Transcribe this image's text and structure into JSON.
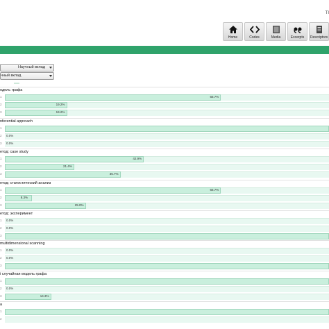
{
  "header": {
    "corner_text": "TI"
  },
  "nav": [
    {
      "label": "Home",
      "icon": "home-icon"
    },
    {
      "label": "Codes",
      "icon": "code-icon"
    },
    {
      "label": "Media",
      "icon": "media-icon"
    },
    {
      "label": "Excerpts",
      "icon": "quote-icon"
    },
    {
      "label": "Descriptors",
      "icon": "descriptors-icon"
    }
  ],
  "colors": {
    "accent": "#2fa36b",
    "bar_fill": "#c9efdd",
    "track": "#e8f8f1"
  },
  "filters": {
    "select1": "Научный вклад",
    "select2": "чный вклад"
  },
  "sections": [
    {
      "title": "одель графа",
      "rows": [
        {
          "label": "1",
          "value": 66.7,
          "text": "66.7%"
        },
        {
          "label": "2",
          "value": 19.2,
          "text": "19.2%"
        },
        {
          "label": "3",
          "value": 19.2,
          "text": "19.2%"
        }
      ]
    },
    {
      "title": "nferential approach",
      "rows": [
        {
          "label": "1",
          "value": 100,
          "text": ""
        },
        {
          "label": "2",
          "value": 0,
          "text": "0.0%"
        },
        {
          "label": "3",
          "value": 0,
          "text": "0.0%"
        }
      ]
    },
    {
      "title": "етод: case study",
      "rows": [
        {
          "label": "1",
          "value": 42.9,
          "text": "42.9%"
        },
        {
          "label": "2",
          "value": 21.4,
          "text": "21.4%"
        },
        {
          "label": "3",
          "value": 35.7,
          "text": "35.7%"
        }
      ]
    },
    {
      "title": "етод: статистический анализ",
      "rows": [
        {
          "label": "1",
          "value": 66.7,
          "text": "66.7%"
        },
        {
          "label": "2",
          "value": 8.3,
          "text": "8.3%"
        },
        {
          "label": "3",
          "value": 25.0,
          "text": "25.0%"
        }
      ]
    },
    {
      "title": "етод: эксперимент",
      "rows": [
        {
          "label": "1",
          "value": 0,
          "text": "0.0%"
        },
        {
          "label": "2",
          "value": 0,
          "text": "0.0%"
        },
        {
          "label": "3",
          "value": 100,
          "text": ""
        }
      ]
    },
    {
      "title": "multidimensional scanning",
      "rows": [
        {
          "label": "1",
          "value": 0,
          "text": "0.0%"
        },
        {
          "label": "2",
          "value": 0,
          "text": "0.0%"
        },
        {
          "label": "3",
          "value": 100,
          "text": ""
        }
      ]
    },
    {
      "title": "і случайная модель графа",
      "rows": [
        {
          "label": "1",
          "value": 100,
          "text": ""
        },
        {
          "label": "2",
          "value": 0,
          "text": "0.0%"
        },
        {
          "label": "3",
          "value": 14.3,
          "text": "14.3%"
        }
      ]
    },
    {
      "title": "а",
      "rows": [
        {
          "label": "1",
          "value": 100,
          "text": ""
        },
        {
          "label": "2",
          "value": 0,
          "text": ""
        }
      ]
    }
  ]
}
